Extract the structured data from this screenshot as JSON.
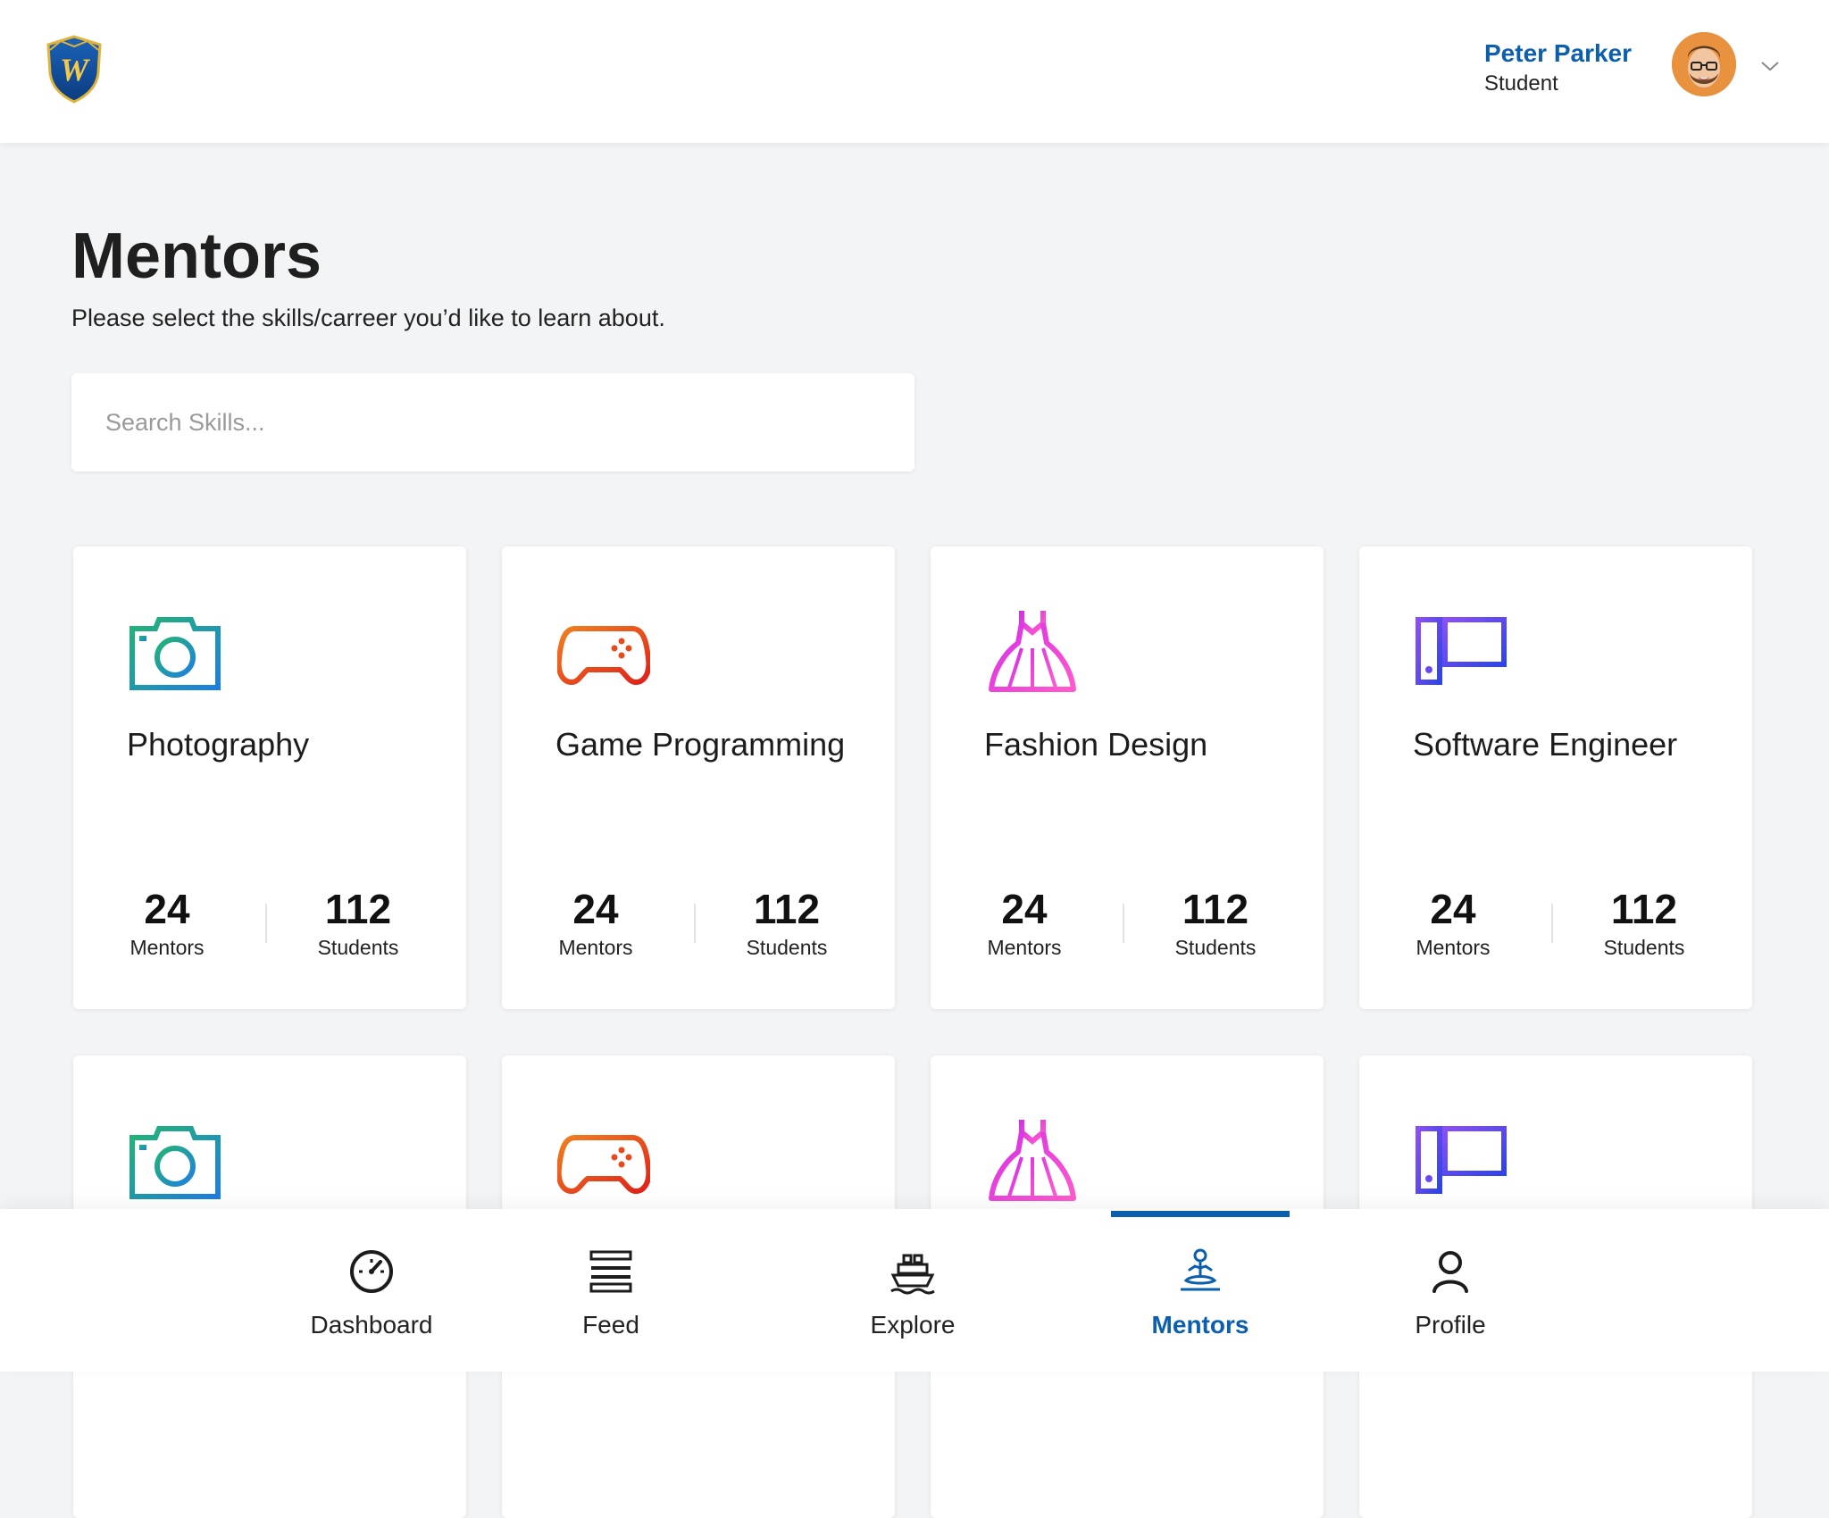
{
  "header": {
    "user_name": "Peter Parker",
    "user_role": "Student"
  },
  "page": {
    "title": "Mentors",
    "subtitle": "Please select the skills/carreer you’d like to learn about.",
    "search_placeholder": "Search Skills..."
  },
  "stat_labels": {
    "mentors": "Mentors",
    "students": "Students"
  },
  "cards": [
    {
      "title": "Photography",
      "mentors": "24",
      "students": "112",
      "icon": "camera-icon"
    },
    {
      "title": "Game Programming",
      "mentors": "24",
      "students": "112",
      "icon": "gamepad-icon"
    },
    {
      "title": "Fashion Design",
      "mentors": "24",
      "students": "112",
      "icon": "dress-icon"
    },
    {
      "title": "Software Engineer",
      "mentors": "24",
      "students": "112",
      "icon": "computer-icon"
    }
  ],
  "nav": {
    "items": [
      {
        "label": "Dashboard",
        "icon": "speedometer-icon"
      },
      {
        "label": "Feed",
        "icon": "feed-icon"
      },
      {
        "label": "Explore",
        "icon": "ship-icon"
      },
      {
        "label": "Mentors",
        "icon": "meditation-icon",
        "active": true
      },
      {
        "label": "Profile",
        "icon": "person-icon"
      }
    ]
  },
  "colors": {
    "brand": "#0b5fad",
    "photography": "#1fb38a",
    "game": "#e8511e",
    "fashion": "#e23ae0",
    "software": "#5b3ff0"
  }
}
